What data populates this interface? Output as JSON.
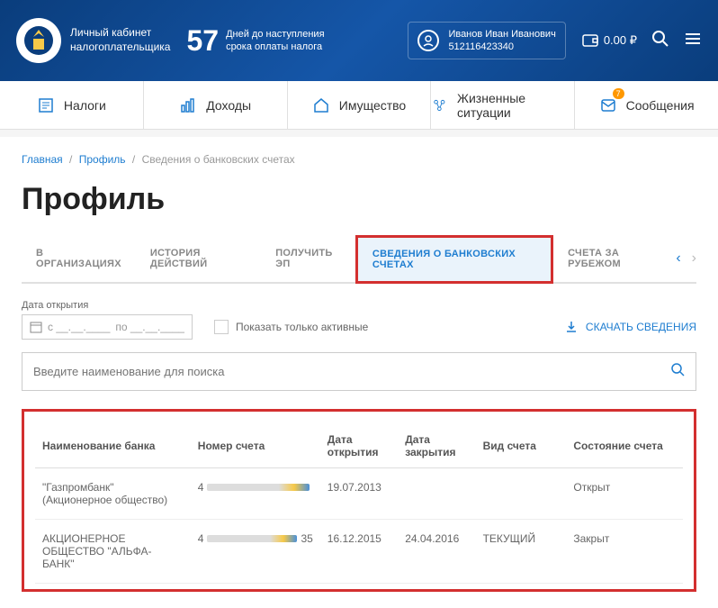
{
  "header": {
    "logo_line1": "Личный кабинет",
    "logo_line2": "налогоплательщика",
    "days_num": "57",
    "days_line1": "Дней до наступления",
    "days_line2": "срока оплаты налога",
    "user_name": "Иванов Иван Иванович",
    "user_id": "512116423340",
    "balance": "0.00 ₽"
  },
  "nav": {
    "taxes": "Налоги",
    "income": "Доходы",
    "property": "Имущество",
    "lifesituations": "Жизненные ситуации",
    "messages": "Сообщения",
    "msg_badge": "7"
  },
  "breadcrumb": {
    "home": "Главная",
    "profile": "Профиль",
    "current": "Сведения о банковских счетах"
  },
  "page_title": "Профиль",
  "tabs": {
    "org": "В ОРГАНИЗАЦИЯХ",
    "history": "ИСТОРИЯ ДЕЙСТВИЙ",
    "ep": "ПОЛУЧИТЬ ЭП",
    "bank": "СВЕДЕНИЯ О БАНКОВСКИХ СЧЕТАХ",
    "foreign": "СЧЕТА ЗА РУБЕЖОМ"
  },
  "filters": {
    "date_label": "Дата открытия",
    "date_from_ph": "с __.__.____",
    "date_to_ph": "по __.__.____",
    "active_only": "Показать только активные",
    "download": "СКАЧАТЬ СВЕДЕНИЯ",
    "search_ph": "Введите наименование для поиска"
  },
  "table": {
    "headers": {
      "bank": "Наименование банка",
      "acct": "Номер счета",
      "opened": "Дата открытия",
      "closed": "Дата закрытия",
      "type": "Вид счета",
      "status": "Состояние счета"
    },
    "rows": [
      {
        "bank": "\"Газпромбанк\" (Акционерное общество)",
        "acct_start": "4",
        "acct_end": "",
        "opened": "19.07.2013",
        "closed": "",
        "type": "",
        "status": "Открыт"
      },
      {
        "bank": "АКЦИОНЕРНОЕ ОБЩЕСТВО \"АЛЬФА-БАНК\"",
        "acct_start": "4",
        "acct_end": "35",
        "opened": "16.12.2015",
        "closed": "24.04.2016",
        "type": "ТЕКУЩИЙ",
        "status": "Закрыт"
      }
    ]
  }
}
